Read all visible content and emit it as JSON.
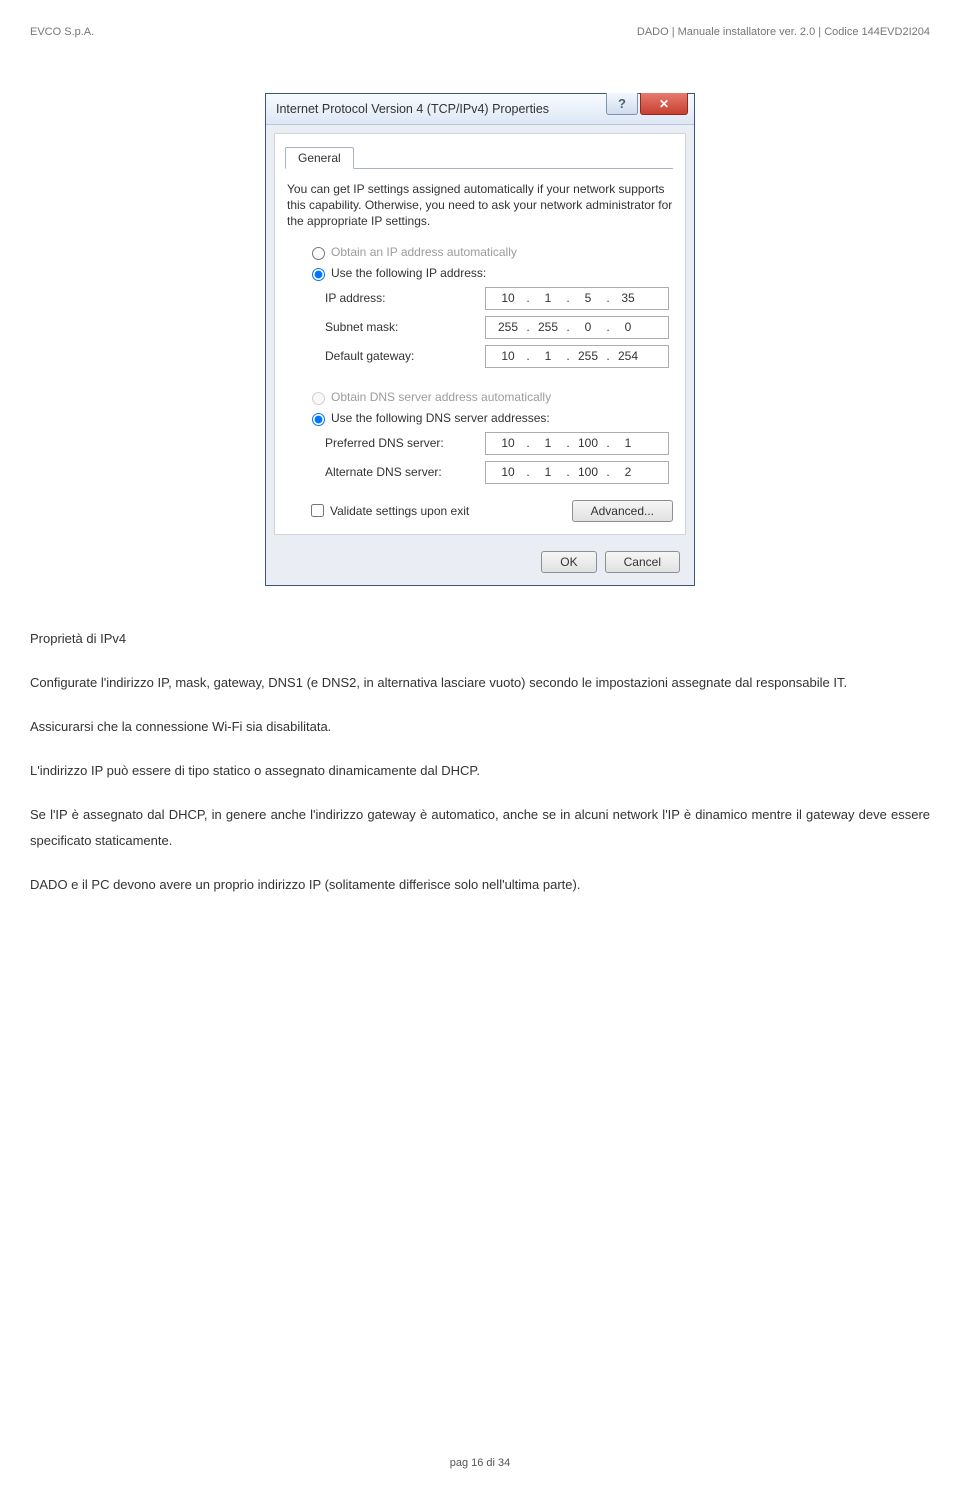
{
  "header": {
    "left": "EVCO S.p.A.",
    "right": "DADO | Manuale installatore ver. 2.0 | Codice 144EVD2I204"
  },
  "dialog": {
    "title": "Internet Protocol Version 4 (TCP/IPv4) Properties",
    "tab": "General",
    "info": "You can get IP settings assigned automatically if your network supports this capability. Otherwise, you need to ask your network administrator for the appropriate IP settings.",
    "radio_ip_auto": "Obtain an IP address automatically",
    "radio_ip_manual": "Use the following IP address:",
    "ip_label": "IP address:",
    "ip": [
      "10",
      "1",
      "5",
      "35"
    ],
    "subnet_label": "Subnet mask:",
    "subnet": [
      "255",
      "255",
      "0",
      "0"
    ],
    "gateway_label": "Default gateway:",
    "gateway": [
      "10",
      "1",
      "255",
      "254"
    ],
    "radio_dns_auto": "Obtain DNS server address automatically",
    "radio_dns_manual": "Use the following DNS server addresses:",
    "dns1_label": "Preferred DNS server:",
    "dns1": [
      "10",
      "1",
      "100",
      "1"
    ],
    "dns2_label": "Alternate DNS server:",
    "dns2": [
      "10",
      "1",
      "100",
      "2"
    ],
    "validate": "Validate settings upon exit",
    "advanced": "Advanced...",
    "ok": "OK",
    "cancel": "Cancel"
  },
  "body": {
    "p1": "Proprietà di IPv4",
    "p2": "Configurate l'indirizzo IP, mask, gateway, DNS1 (e DNS2, in alternativa lasciare vuoto) secondo le impostazioni assegnate dal responsabile IT.",
    "p3": "Assicurarsi che la connessione Wi-Fi sia disabilitata.",
    "p4": "L'indirizzo IP può essere di tipo statico o assegnato dinamicamente dal DHCP.",
    "p5": "Se l'IP è assegnato dal DHCP, in genere anche l'indirizzo gateway è automatico, anche se in alcuni network l'IP è dinamico mentre il gateway deve essere specificato staticamente.",
    "p6": "DADO e il PC devono avere un proprio indirizzo IP (solitamente differisce solo nell'ultima parte)."
  },
  "footer": "pag 16 di 34"
}
